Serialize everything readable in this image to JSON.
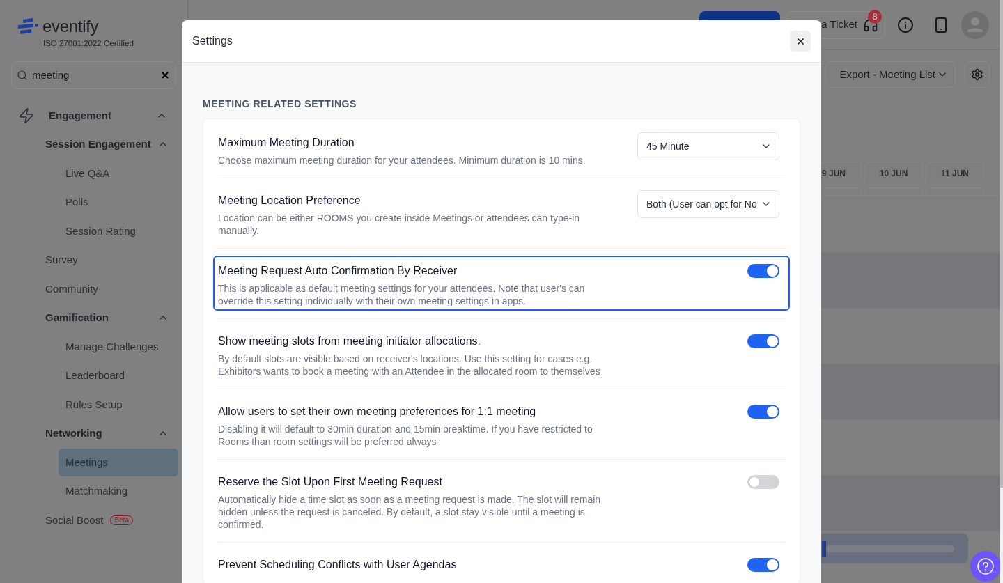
{
  "sidebar": {
    "logo": {
      "wordmark": "eventify",
      "tagline": "ISO 27001:2022 Certified"
    },
    "search": {
      "value": "meeting"
    },
    "nav": [
      {
        "kind": "section",
        "label": "Engagement",
        "expanded": true,
        "children": [
          {
            "kind": "group",
            "label": "Session Engagement",
            "expanded": true,
            "children": [
              {
                "kind": "link",
                "label": "Live Q&A",
                "selected": false
              },
              {
                "kind": "link",
                "label": "Polls",
                "selected": false
              },
              {
                "kind": "link",
                "label": "Session Rating",
                "selected": false
              }
            ]
          },
          {
            "kind": "link",
            "label": "Survey",
            "selected": false
          },
          {
            "kind": "link",
            "label": "Community",
            "selected": false
          },
          {
            "kind": "group",
            "label": "Gamification",
            "expanded": true,
            "children": [
              {
                "kind": "link",
                "label": "Manage Challenges",
                "selected": false
              },
              {
                "kind": "link",
                "label": "Leaderboard",
                "selected": false
              },
              {
                "kind": "link",
                "label": "Rules Setup",
                "selected": false
              }
            ]
          },
          {
            "kind": "group",
            "label": "Networking",
            "expanded": true,
            "children": [
              {
                "kind": "link",
                "label": "Meetings",
                "selected": true
              },
              {
                "kind": "link",
                "label": "Matchmaking",
                "selected": false
              }
            ]
          },
          {
            "kind": "link",
            "label": "Social Boost",
            "selected": false,
            "badge": "Beta"
          }
        ]
      }
    ]
  },
  "header": {
    "ticket_button": {
      "label": "a Ticket",
      "badge": "8"
    }
  },
  "toolbar": {
    "export_button": "Export - Meeting List"
  },
  "calendar": {
    "columns": [
      "9 JUN",
      "10 JUN",
      "11 JUN"
    ]
  },
  "dialog": {
    "title": "Settings",
    "section_title": "MEETING RELATED SETTINGS",
    "settings": [
      {
        "kind": "select",
        "title": "Maximum Meeting Duration",
        "description": "Choose maximum meeting duration for your attendees. Minimum duration is 10 mins.",
        "value": "45 Minute",
        "focused": false
      },
      {
        "kind": "select",
        "title": "Meeting Location Preference",
        "description": "Location can be either ROOMS you create inside Meetings or attendees can type-in manually.",
        "value": "Both (User can opt for No",
        "focused": false
      },
      {
        "kind": "toggle",
        "title": "Meeting Request Auto Confirmation By Receiver",
        "description": "This is applicable as default meeting settings for your attendees. Note that user's can override this setting individually with their own meeting settings in apps.",
        "on": true,
        "focused": true
      },
      {
        "kind": "toggle",
        "title": "Show meeting slots from meeting initiator allocations.",
        "description": "By default slots are visible based on receiver's locations. Use this setting for cases e.g. Exhibitors wants to book a meeting with an Attendee in the allocated room to themselves",
        "on": true,
        "focused": false
      },
      {
        "kind": "toggle",
        "title": "Allow users to set their own meeting preferences for 1:1 meeting",
        "description": "Disabling it will default to 30min duration and 15min breaktime. If you have restricted to Rooms than room settings will be preferred always",
        "on": true,
        "focused": false
      },
      {
        "kind": "toggle",
        "title": "Reserve the Slot Upon First Meeting Request",
        "description": "Automatically hide a time slot as soon as a meeting request is made. The slot will remain hidden unless the request is canceled. By default, a slot stay visible until a meeting is confirmed.",
        "on": false,
        "focused": false
      },
      {
        "kind": "toggle",
        "title": "Prevent Scheduling Conflicts with User Agendas",
        "on": true,
        "focused": false
      }
    ]
  }
}
